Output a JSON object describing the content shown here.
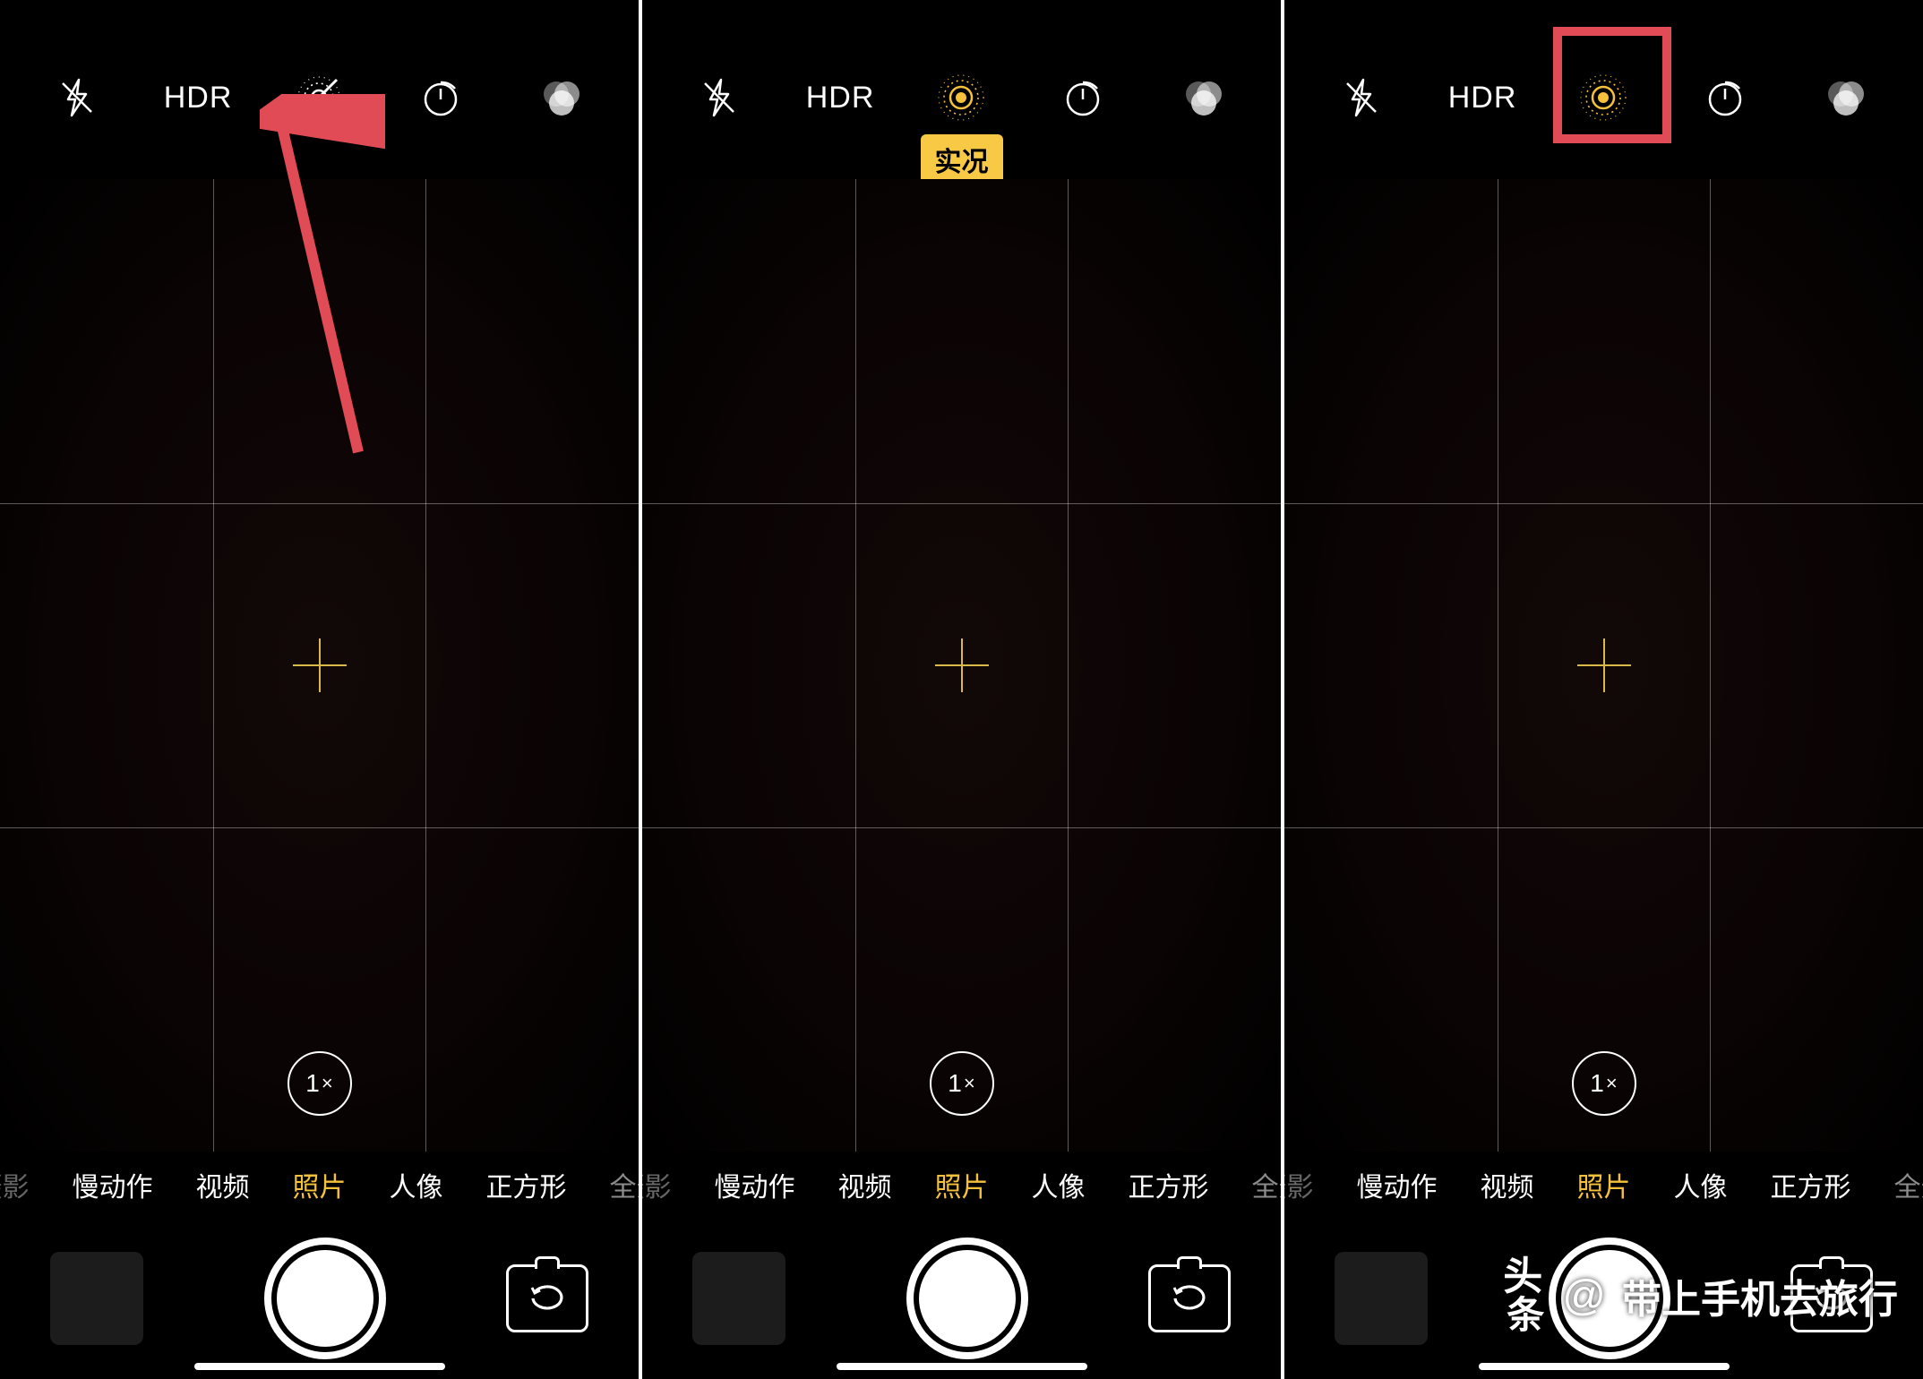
{
  "toolbar": {
    "hdr_label": "HDR"
  },
  "live_badge": "实况",
  "zoom": {
    "value": "1",
    "suffix": "×"
  },
  "modes": {
    "m0_left_clip": "摄影",
    "m1": "慢动作",
    "m2": "视频",
    "m3_active": "照片",
    "m4": "人像",
    "m5": "正方形",
    "m6_right_clip": "全景"
  },
  "watermark": {
    "logo_top": "头",
    "logo_bot": "条",
    "at": "@",
    "text": "带上手机去旅行"
  },
  "annotations": {
    "panel1_arrow": true,
    "panel3_redbox": true
  }
}
